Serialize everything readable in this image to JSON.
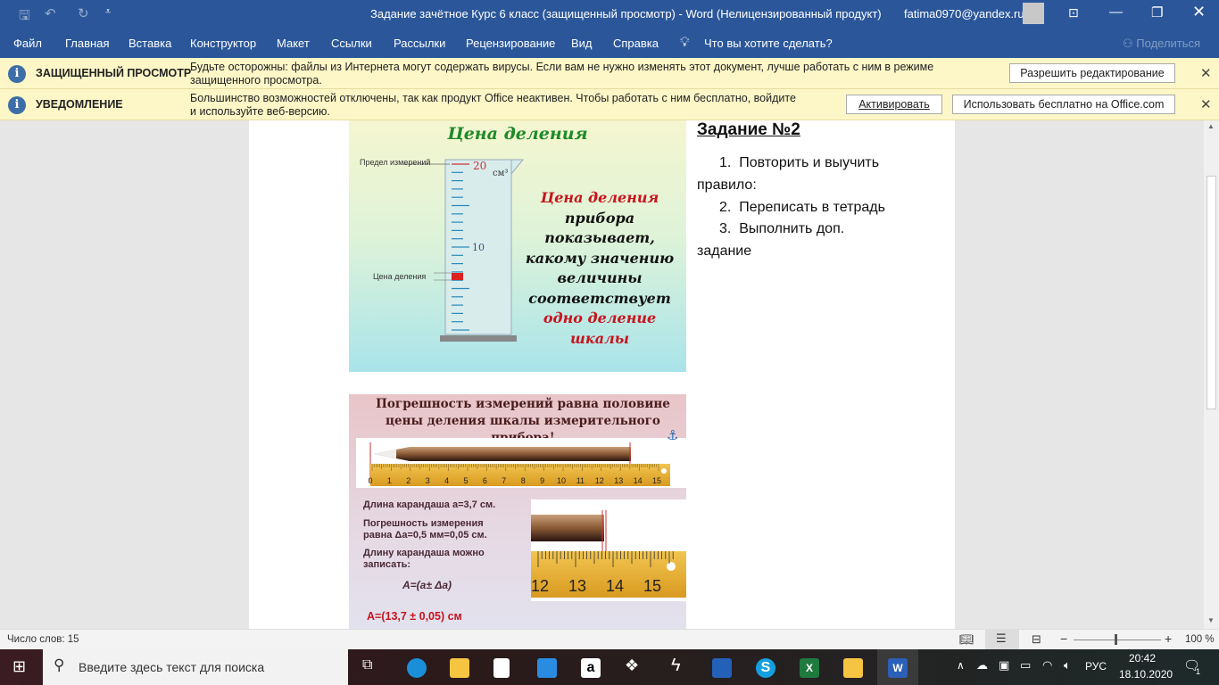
{
  "titlebar": {
    "title": "Задание зачётное Курс 6 класс (защищенный просмотр)  -  Word (Нелицензированный продукт)",
    "user": "fatima0970@yandex.ru"
  },
  "ribbon": {
    "tabs": [
      "Файл",
      "Главная",
      "Вставка",
      "Конструктор",
      "Макет",
      "Ссылки",
      "Рассылки",
      "Рецензирование",
      "Вид",
      "Справка"
    ],
    "tell_me": "Что вы хотите сделать?",
    "share": "Поделиться"
  },
  "protected": {
    "label": "ЗАЩИЩЕННЫЙ ПРОСМОТР",
    "message": "Будьте осторожны: файлы из Интернета могут содержать вирусы. Если вам не нужно изменять этот документ, лучше работать с ним в режиме защищенного просмотра.",
    "button": "Разрешить редактирование"
  },
  "notice": {
    "label": "УВЕДОМЛЕНИЕ",
    "message": "Большинство возможностей отключены, так как продукт Office неактивен. Чтобы работать с ним бесплатно, войдите и используйте веб-версию.",
    "activate": "Активировать",
    "free": "Использовать бесплатно на Office.com"
  },
  "image1": {
    "title": "Цена деления",
    "limit_label": "Предел измерений",
    "top_value": "20",
    "mid_value": "10",
    "unit": "см³",
    "division_label": "Цена деления",
    "text_red1": "Цена деления",
    "text_black1": " прибора показывает, какому значению величины соответствует ",
    "text_red2": "одно деление шкалы"
  },
  "image2": {
    "title": "Погрешность измерений равна половине цены деления шкалы измерительного прибора!",
    "ruler_numbers": [
      "0",
      "1",
      "2",
      "3",
      "4",
      "5",
      "6",
      "7",
      "8",
      "9",
      "10",
      "11",
      "12",
      "13",
      "14",
      "15"
    ],
    "zoom_numbers": [
      "12",
      "13",
      "14",
      "15"
    ],
    "line1": "Длина карандаша a=3,7 см.",
    "line2": "Погрешность измерения равна Δa=0,5 мм=0,05 см.",
    "line3": "Длину карандаша можно записать:",
    "formula": "A=(a± Δa)",
    "result": "A=(13,7 ± 0,05) см"
  },
  "document": {
    "heading": "Задание №2",
    "items": [
      {
        "num": "1.",
        "text": "Повторить и выучить"
      },
      {
        "num": "2.",
        "text": "Переписать в тетрадь"
      },
      {
        "num": "3.",
        "text": "Выполнить доп."
      }
    ],
    "cont1": "правило:",
    "cont3": "задание"
  },
  "status": {
    "words": "Число слов: 15",
    "zoom": "100 %"
  },
  "taskbar": {
    "search": "Введите здесь текст для поиска",
    "lang": "РУС",
    "time": "20:42",
    "date": "18.10.2020",
    "notif_count": "1"
  }
}
